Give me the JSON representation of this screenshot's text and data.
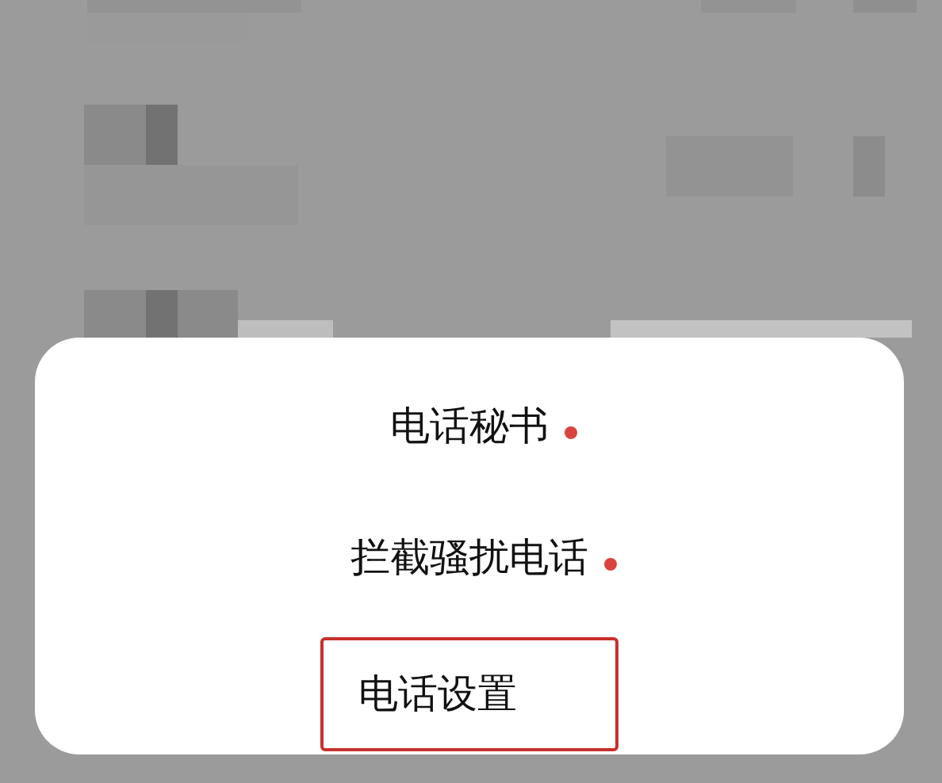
{
  "menu": {
    "items": [
      {
        "label": "电话秘书",
        "badge": true,
        "highlighted": false
      },
      {
        "label": "拦截骚扰电话",
        "badge": true,
        "highlighted": false
      },
      {
        "label": "电话设置",
        "badge": false,
        "highlighted": true
      }
    ]
  }
}
